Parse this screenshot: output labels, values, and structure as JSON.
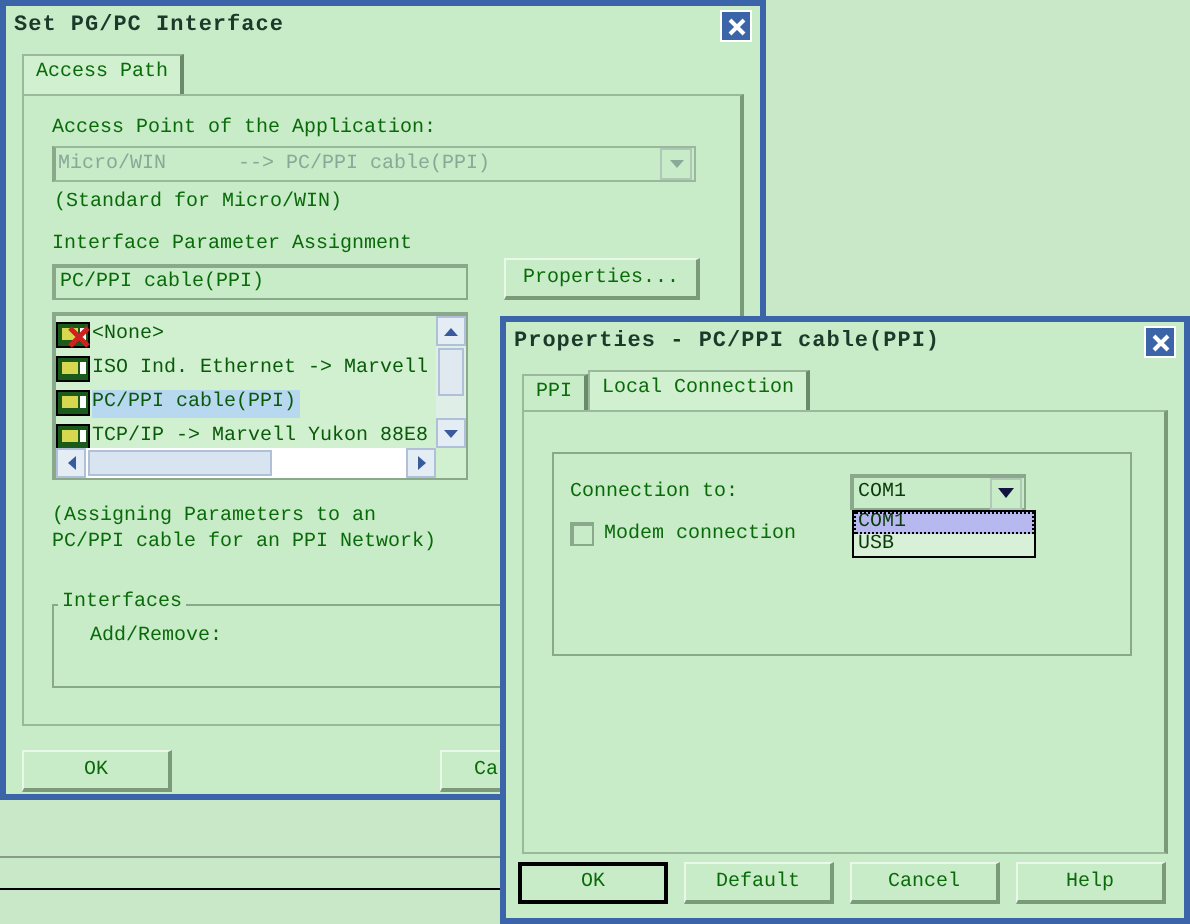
{
  "main_window": {
    "title": "Set PG/PC Interface",
    "tabs": [
      {
        "label": "Access Path",
        "selected": true
      }
    ],
    "access_point": {
      "label": "Access Point of the Application:",
      "value": "Micro/WIN      --> PC/PPI cable(PPI)",
      "disabled": true
    },
    "access_point_note": "(Standard for Micro/WIN)",
    "parameter_label": "Interface Parameter Assignment",
    "parameter_value": "PC/PPI cable(PPI)",
    "properties_button": "Properties...",
    "interfaces": [
      {
        "label": "<None>",
        "kind": "none",
        "selected": false
      },
      {
        "label": "ISO Ind. Ethernet -> Marvell",
        "kind": "card",
        "selected": false
      },
      {
        "label": "PC/PPI cable(PPI)",
        "kind": "card",
        "selected": true
      },
      {
        "label": "TCP/IP -> Marvell Yukon 88E8",
        "kind": "card",
        "selected": false
      }
    ],
    "description": "(Assigning Parameters to an PC/PPI cable for an PPI Network)",
    "interfaces_group": {
      "title": "Interfaces",
      "add_remove_label": "Add/Remove:"
    },
    "buttons": [
      "OK",
      "Ca"
    ]
  },
  "properties_window": {
    "title": "Properties - PC/PPI cable(PPI)",
    "tabs": [
      {
        "label": "PPI",
        "selected": false
      },
      {
        "label": "Local Connection",
        "selected": true
      }
    ],
    "connection_label": "Connection to:",
    "connection_value": "COM1",
    "dropdown_options": [
      {
        "label": "COM1",
        "selected": true
      },
      {
        "label": "USB",
        "selected": false
      }
    ],
    "modem": {
      "label": "Modem connection",
      "checked": false
    },
    "buttons": [
      {
        "label": "OK",
        "default": true
      },
      {
        "label": "Default",
        "default": false
      },
      {
        "label": "Cancel",
        "default": false
      },
      {
        "label": "Help",
        "default": false
      }
    ]
  }
}
